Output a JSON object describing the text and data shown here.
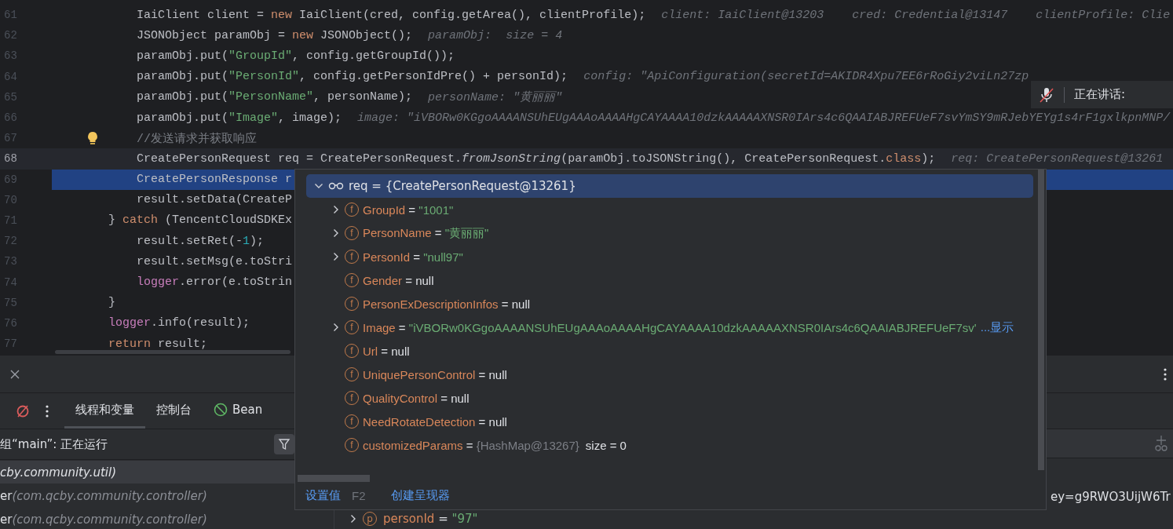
{
  "editor": {
    "lines": [
      {
        "number": "61",
        "selected": false,
        "caret": false,
        "bulb": false,
        "tokens": [
          {
            "text": "            IaiClient client = ",
            "kind": "plain"
          },
          {
            "text": "new",
            "kind": "keyword"
          },
          {
            "text": " IaiClient(cred, config.getArea(), clientProfile);",
            "kind": "plain"
          }
        ],
        "hints": [
          "client: IaiClient@13203",
          "cred: Credential@13147",
          "clientProfile: Clie"
        ]
      },
      {
        "number": "62",
        "selected": false,
        "caret": false,
        "bulb": false,
        "tokens": [
          {
            "text": "            JSONObject paramObj = ",
            "kind": "plain"
          },
          {
            "text": "new",
            "kind": "keyword"
          },
          {
            "text": " JSONObject();",
            "kind": "plain"
          }
        ],
        "hints": [
          "paramObj:  size = 4"
        ]
      },
      {
        "number": "63",
        "selected": false,
        "caret": false,
        "bulb": false,
        "tokens": [
          {
            "text": "            paramObj.put(",
            "kind": "plain"
          },
          {
            "text": "\"GroupId\"",
            "kind": "string"
          },
          {
            "text": ", config.getGroupId());",
            "kind": "plain"
          }
        ]
      },
      {
        "number": "64",
        "selected": false,
        "caret": false,
        "bulb": false,
        "tokens": [
          {
            "text": "            paramObj.put(",
            "kind": "plain"
          },
          {
            "text": "\"PersonId\"",
            "kind": "string"
          },
          {
            "text": ", config.getPersonIdPre() + personId);",
            "kind": "plain"
          }
        ],
        "hints": [
          "config: \"ApiConfiguration(secretId=AKIDR4Xpu7EE6rRoGiy2viLn27zp"
        ]
      },
      {
        "number": "65",
        "selected": false,
        "caret": false,
        "bulb": false,
        "tokens": [
          {
            "text": "            paramObj.put(",
            "kind": "plain"
          },
          {
            "text": "\"PersonName\"",
            "kind": "string"
          },
          {
            "text": ", personName);",
            "kind": "plain"
          }
        ],
        "hints": [
          "personName: \"黄丽丽\""
        ]
      },
      {
        "number": "66",
        "selected": false,
        "caret": false,
        "bulb": false,
        "tokens": [
          {
            "text": "            paramObj.put(",
            "kind": "plain"
          },
          {
            "text": "\"Image\"",
            "kind": "string"
          },
          {
            "text": ", image);",
            "kind": "plain"
          }
        ],
        "hints": [
          "image: \"iVBORw0KGgoAAAANSUhEUgAAAoAAAAHgCAYAAAA10dzkAAAAAXNSR0IArs4c6QAAIABJREFUeF7svYmSY9mRJebYEYg1s4rF1gxlkpnMNP/"
        ]
      },
      {
        "number": "67",
        "selected": false,
        "caret": false,
        "bulb": true,
        "tokens": [
          {
            "text": "            //发送请求并获取响应",
            "kind": "comment"
          }
        ]
      },
      {
        "number": "68",
        "selected": false,
        "caret": true,
        "bulb": false,
        "tokens": [
          {
            "text": "            CreatePersonRequest req = CreatePersonRequest.",
            "kind": "plain"
          },
          {
            "text": "fromJsonString",
            "kind": "static"
          },
          {
            "text": "(paramObj.toJSONString(), CreatePersonRequest.",
            "kind": "plain"
          },
          {
            "text": "class",
            "kind": "keyword"
          },
          {
            "text": ");",
            "kind": "plain"
          }
        ],
        "hints": [
          "req: CreatePersonRequest@13261"
        ]
      },
      {
        "number": "69",
        "selected": true,
        "caret": false,
        "bulb": false,
        "tokens": [
          {
            "text": "            CreatePersonResponse r",
            "kind": "plain"
          }
        ]
      },
      {
        "number": "70",
        "selected": false,
        "caret": false,
        "bulb": false,
        "tokens": [
          {
            "text": "            result.setData(CreateP",
            "kind": "plain"
          }
        ]
      },
      {
        "number": "71",
        "selected": false,
        "caret": false,
        "bulb": false,
        "tokens": [
          {
            "text": "        } ",
            "kind": "plain"
          },
          {
            "text": "catch",
            "kind": "keyword"
          },
          {
            "text": " (TencentCloudSDKEx",
            "kind": "plain"
          }
        ]
      },
      {
        "number": "72",
        "selected": false,
        "caret": false,
        "bulb": false,
        "tokens": [
          {
            "text": "            result.setRet(-",
            "kind": "plain"
          },
          {
            "text": "1",
            "kind": "number"
          },
          {
            "text": ");",
            "kind": "plain"
          }
        ]
      },
      {
        "number": "73",
        "selected": false,
        "caret": false,
        "bulb": false,
        "tokens": [
          {
            "text": "            result.setMsg(e.toStri",
            "kind": "plain"
          }
        ]
      },
      {
        "number": "74",
        "selected": false,
        "caret": false,
        "bulb": false,
        "tokens": [
          {
            "text": "            logger",
            "kind": "field"
          },
          {
            "text": ".error(e.toStrin",
            "kind": "plain"
          }
        ]
      },
      {
        "number": "75",
        "selected": false,
        "caret": false,
        "bulb": false,
        "tokens": [
          {
            "text": "        }",
            "kind": "plain"
          }
        ]
      },
      {
        "number": "76",
        "selected": false,
        "caret": false,
        "bulb": false,
        "tokens": [
          {
            "text": "        logger",
            "kind": "field"
          },
          {
            "text": ".info(result);",
            "kind": "plain"
          }
        ]
      },
      {
        "number": "77",
        "selected": false,
        "caret": false,
        "bulb": false,
        "tokens": [
          {
            "text": "        return",
            "kind": "keyword"
          },
          {
            "text": " result;",
            "kind": "plain"
          }
        ]
      }
    ]
  },
  "voice_indicator": {
    "text": "正在讲话:"
  },
  "popup": {
    "separator": "=",
    "root": {
      "name": "req",
      "value": "{CreatePersonRequest@13261}",
      "selected": true,
      "expanded": true
    },
    "fields": [
      {
        "badge": "f",
        "name": "GroupId",
        "value": "\"1001\"",
        "kind": "string",
        "expandable": true
      },
      {
        "badge": "f",
        "name": "PersonName",
        "value": "\"黄丽丽\"",
        "kind": "string",
        "expandable": true
      },
      {
        "badge": "f",
        "name": "PersonId",
        "value": "\"null97\"",
        "kind": "string",
        "expandable": true
      },
      {
        "badge": "f",
        "name": "Gender",
        "value": "null",
        "kind": "null",
        "expandable": false
      },
      {
        "badge": "f",
        "name": "PersonExDescriptionInfos",
        "value": "null",
        "kind": "null",
        "expandable": false
      },
      {
        "badge": "f",
        "name": "Image",
        "value": "\"iVBORw0KGgoAAAANSUhEUgAAAoAAAAHgCAYAAAA10dzkAAAAAXNSR0IArs4c6QAAIABJREFUeF7sv'",
        "kind": "string",
        "expandable": true,
        "more": "...显示"
      },
      {
        "badge": "f",
        "name": "Url",
        "value": "null",
        "kind": "null",
        "expandable": false
      },
      {
        "badge": "f",
        "name": "UniquePersonControl",
        "value": "null",
        "kind": "null",
        "expandable": false
      },
      {
        "badge": "f",
        "name": "QualityControl",
        "value": "null",
        "kind": "null",
        "expandable": false
      },
      {
        "badge": "f",
        "name": "NeedRotateDetection",
        "value": "null",
        "kind": "null",
        "expandable": false
      },
      {
        "badge": "f",
        "name": "customizedParams",
        "value": "{HashMap@13267}",
        "kind": "object",
        "expandable": false,
        "extra": "size = 0"
      }
    ],
    "actions": [
      {
        "label": "设置值",
        "shortcut": "F2"
      },
      {
        "label": "创建呈现器"
      }
    ]
  },
  "debug_panel": {
    "tabs": [
      {
        "label": "线程和变量",
        "selected": true,
        "kind": "plain"
      },
      {
        "label": "控制台",
        "selected": false,
        "kind": "plain"
      },
      {
        "label": "Bean",
        "selected": false,
        "kind": "bean"
      }
    ],
    "thread": "组“main”: 正在运行",
    "frames": [
      {
        "package": "cby.community.util)",
        "selected": true
      },
      {
        "name": "er",
        "package": "(com.qcby.community.controller)",
        "selected": false
      },
      {
        "name": "er",
        "package": "(com.qcby.community.controller)",
        "selected": false
      }
    ],
    "variables": [
      {
        "kind": "tail",
        "text": "ey=g9RWO3UijW6Tr"
      },
      {
        "kind": "param",
        "badge": "p",
        "name": "personId",
        "separator": "=",
        "value": "\"97\"",
        "expandable": true
      }
    ]
  }
}
